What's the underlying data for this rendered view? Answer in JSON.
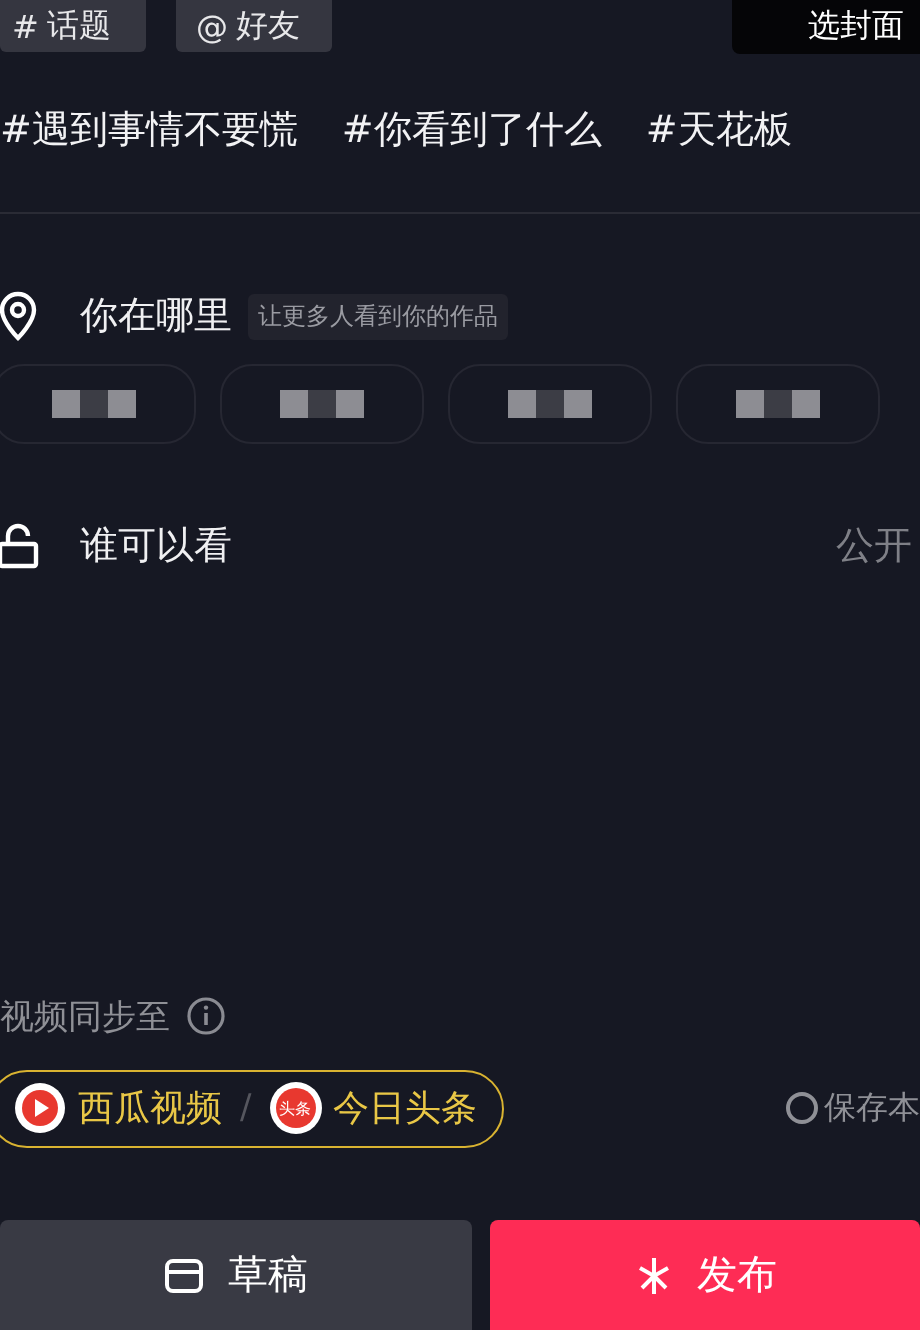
{
  "insert_buttons": [
    {
      "icon": "#",
      "label": "话题"
    },
    {
      "icon": "@",
      "label": "好友"
    }
  ],
  "cover_button": "选封面",
  "hashtags": [
    "#遇到事情不要慌",
    "#你看到了什么",
    "#天花板"
  ],
  "location": {
    "label": "你在哪里",
    "hint": "让更多人看到你的作品",
    "chips": [
      {
        "kind": "redacted"
      },
      {
        "kind": "redacted"
      },
      {
        "kind": "redacted"
      },
      {
        "kind": "redacted"
      }
    ]
  },
  "visibility": {
    "label": "谁可以看",
    "value": "公开"
  },
  "sync": {
    "label": "视频同步至",
    "separator": "/",
    "targets": [
      {
        "kind": "xigua",
        "name": "西瓜视频"
      },
      {
        "kind": "toutiao",
        "badge": "头条",
        "name": "今日头条"
      }
    ],
    "save_local": {
      "label": "保存本",
      "checked": false
    }
  },
  "actions": [
    {
      "kind": "draft",
      "label": "草稿"
    },
    {
      "kind": "publish",
      "label": "发布"
    }
  ]
}
